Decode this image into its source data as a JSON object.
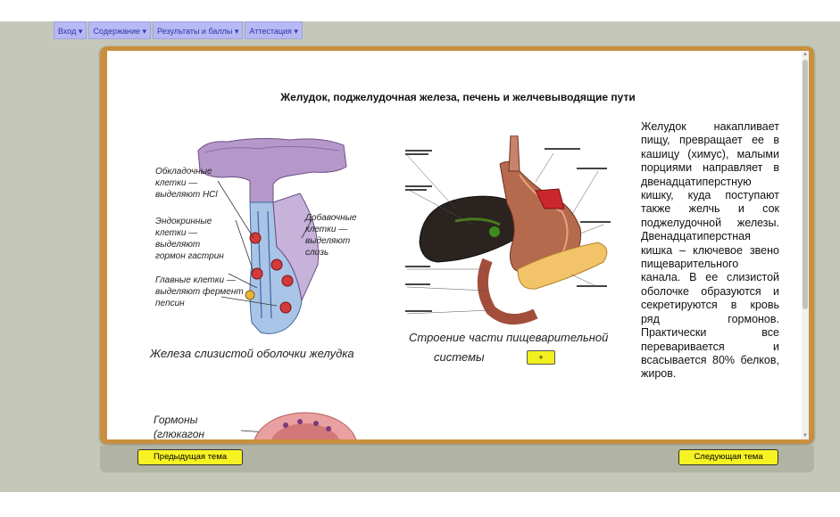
{
  "menu": [
    {
      "label": "Вход ▾"
    },
    {
      "label": "Содержание ▾"
    },
    {
      "label": "Результаты и баллы ▾"
    },
    {
      "label": "Аттестация ▾"
    }
  ],
  "page": {
    "title": "Желудок, поджелудочная железа, печень и желчевыводящие пути",
    "description": "Желудок накапливает пищу, превращает ее в кашицу (химус), малыми порциями направляет в двенадцатиперстную кишку, куда поступают также желчь и сок поджелудочной железы. Двенадцатиперстная кишка – ключевое звено пищеварительного канала. В ее слизистой оболочке образуются и секретируются в кровь ряд гормонов. Практически все переваривается и всасывается 80% белков, жиров."
  },
  "figure_gland": {
    "caption": "Железа слизистой оболочки желудка",
    "labels": [
      {
        "line1": "Обкладочные",
        "line2": "клетки —",
        "line3": "выделяют HCl"
      },
      {
        "line1": "Эндокринные",
        "line2": "клетки —",
        "line3": "выделяют",
        "line4": "гормон гастрин"
      },
      {
        "line1": "Главные клетки —",
        "line2": "выделяют фермент",
        "line3": "пепсин"
      },
      {
        "line1": "Добавочные",
        "line2": "клетки —",
        "line3": "выделяют",
        "line4": "слизь"
      }
    ]
  },
  "figure_digestive": {
    "caption_line1": "Строение части пищеварительной",
    "caption_line2": "системы",
    "zoom_button": "+"
  },
  "figure_bottom": {
    "label_line1": "Гормоны",
    "label_line2": "(глюкагон"
  },
  "footer": {
    "prev_label": "Предыдущая тема",
    "next_label": "Следующая тема"
  }
}
